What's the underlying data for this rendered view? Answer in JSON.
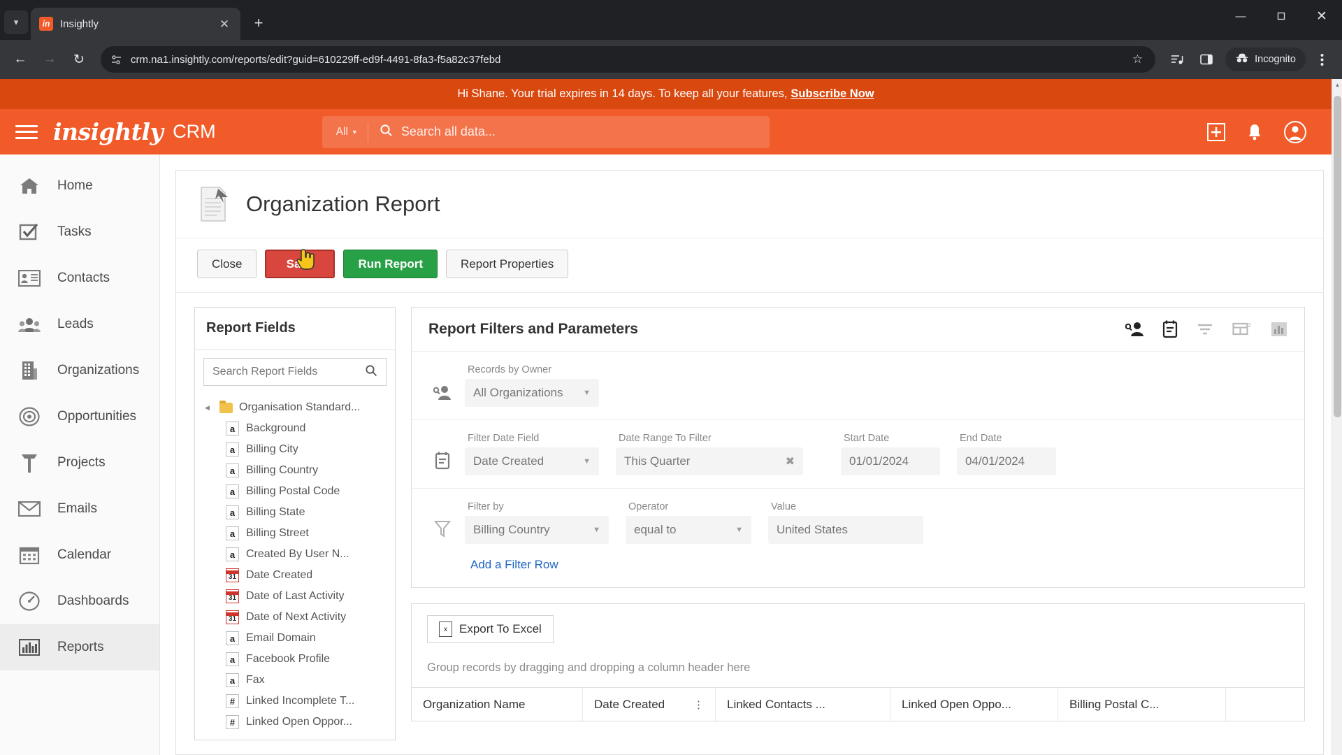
{
  "browser": {
    "tab": {
      "title": "Insightly",
      "favicon_label": "in",
      "close_icon": "close-icon"
    },
    "new_tab_label": "+",
    "tab_search_icon": "chevron-down-icon",
    "window": {
      "minimize": "—",
      "maximize": "❐",
      "close": "✕"
    },
    "nav": {
      "back": "←",
      "forward": "→",
      "reload": "↻"
    },
    "omnibox": {
      "url": "crm.na1.insightly.com/reports/edit?guid=610229ff-ed9f-4491-8fa3-f5a82c37febd",
      "site_info_icon": "site-settings-icon",
      "bookmark_icon": "star-icon"
    },
    "toolbar": {
      "media_icon": "media-playlist-icon",
      "sidepanel_icon": "side-panel-icon",
      "incognito_label": "Incognito",
      "incognito_icon": "incognito-icon",
      "menu_icon": "three-dot-menu-icon"
    }
  },
  "banner": {
    "text": "Hi Shane. Your trial expires in 14 days. To keep all your features,",
    "link": "Subscribe Now"
  },
  "header": {
    "logo": "insightly",
    "product": "CRM",
    "menu_icon": "hamburger-menu-icon",
    "search": {
      "scope": "All",
      "placeholder": "Search all data...",
      "icon": "search-icon"
    },
    "add_icon": "add-plus-icon",
    "bell_icon": "notifications-bell-icon",
    "avatar_icon": "user-account-icon"
  },
  "sidebar": {
    "items": [
      {
        "label": "Home",
        "icon": "home-icon",
        "active": false
      },
      {
        "label": "Tasks",
        "icon": "tasks-checkbox-icon",
        "active": false
      },
      {
        "label": "Contacts",
        "icon": "contacts-card-icon",
        "active": false
      },
      {
        "label": "Leads",
        "icon": "leads-people-icon",
        "active": false
      },
      {
        "label": "Organizations",
        "icon": "organizations-building-icon",
        "active": false
      },
      {
        "label": "Opportunities",
        "icon": "opportunities-target-icon",
        "active": false
      },
      {
        "label": "Projects",
        "icon": "projects-hammer-icon",
        "active": false
      },
      {
        "label": "Emails",
        "icon": "emails-envelope-icon",
        "active": false
      },
      {
        "label": "Calendar",
        "icon": "calendar-icon",
        "active": false
      },
      {
        "label": "Dashboards",
        "icon": "dashboards-gauge-icon",
        "active": false
      },
      {
        "label": "Reports",
        "icon": "reports-bar-chart-icon",
        "active": true
      }
    ]
  },
  "report": {
    "title": "Organization Report",
    "title_icon": "report-document-icon",
    "buttons": {
      "close": "Close",
      "save": "Save",
      "run": "Run Report",
      "properties": "Report Properties"
    },
    "cursor_icon": "pointing-hand-cursor"
  },
  "fields_panel": {
    "title": "Report Fields",
    "search_placeholder": "Search Report Fields",
    "search_value": "",
    "search_icon": "search-icon",
    "root": "Organisation Standard...",
    "items": [
      {
        "label": "Background",
        "type": "a"
      },
      {
        "label": "Billing City",
        "type": "a"
      },
      {
        "label": "Billing Country",
        "type": "a"
      },
      {
        "label": "Billing Postal Code",
        "type": "a"
      },
      {
        "label": "Billing State",
        "type": "a"
      },
      {
        "label": "Billing Street",
        "type": "a"
      },
      {
        "label": "Created By User N...",
        "type": "a"
      },
      {
        "label": "Date Created",
        "type": "date"
      },
      {
        "label": "Date of Last Activity",
        "type": "date"
      },
      {
        "label": "Date of Next Activity",
        "type": "date"
      },
      {
        "label": "Email Domain",
        "type": "a"
      },
      {
        "label": "Facebook Profile",
        "type": "a"
      },
      {
        "label": "Fax",
        "type": "a"
      },
      {
        "label": "Linked Incomplete T...",
        "type": "#"
      },
      {
        "label": "Linked Open Oppor...",
        "type": "#"
      }
    ]
  },
  "filters": {
    "title": "Report Filters and Parameters",
    "icons": [
      {
        "name": "records-by-owner-icon",
        "active": true
      },
      {
        "name": "date-filter-icon",
        "active": true
      },
      {
        "name": "filter-funnel-icon",
        "active": false
      },
      {
        "name": "columns-table-icon",
        "active": false
      },
      {
        "name": "chart-icon",
        "active": false
      }
    ],
    "owner_row": {
      "icon": "records-by-owner-icon",
      "label": "Records by Owner",
      "value": "All Organizations"
    },
    "date_row": {
      "icon": "date-filter-icon",
      "filter_date_field": {
        "label": "Filter Date Field",
        "value": "Date Created"
      },
      "date_range": {
        "label": "Date Range To Filter",
        "value": "This Quarter",
        "clear_icon": "clear-x-icon"
      },
      "start_date": {
        "label": "Start Date",
        "value": "01/01/2024"
      },
      "end_date": {
        "label": "End Date",
        "value": "04/01/2024"
      }
    },
    "filter_row": {
      "icon": "filter-funnel-icon",
      "filter_by": {
        "label": "Filter by",
        "value": "Billing Country"
      },
      "operator": {
        "label": "Operator",
        "value": "equal to"
      },
      "value": {
        "label": "Value",
        "value": "United States"
      }
    },
    "add_filter_row": "Add a Filter Row"
  },
  "results": {
    "export_label": "Export To Excel",
    "export_icon": "excel-file-icon",
    "group_hint": "Group records by dragging and dropping a column header here",
    "columns": [
      "Organization Name",
      "Date Created",
      "Linked Contacts ...",
      "Linked Open Oppo...",
      "Billing Postal C..."
    ],
    "column_menu_icon": "column-kebab-icon"
  },
  "colors": {
    "brand_orange": "#f15a29",
    "banner_orange": "#d9480f",
    "save_red": "#d9463e",
    "run_green": "#28a046",
    "link_blue": "#2066c4"
  }
}
